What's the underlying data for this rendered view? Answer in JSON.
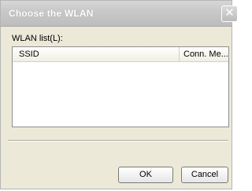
{
  "window": {
    "title": "Choose the WLAN",
    "close_glyph": "✕"
  },
  "wlan_list": {
    "label": "WLAN list(L):",
    "columns": [
      {
        "label": "SSID"
      },
      {
        "label": "Conn. Me..."
      }
    ],
    "rows": []
  },
  "buttons": {
    "ok_label": "OK",
    "cancel_label": "Cancel"
  }
}
